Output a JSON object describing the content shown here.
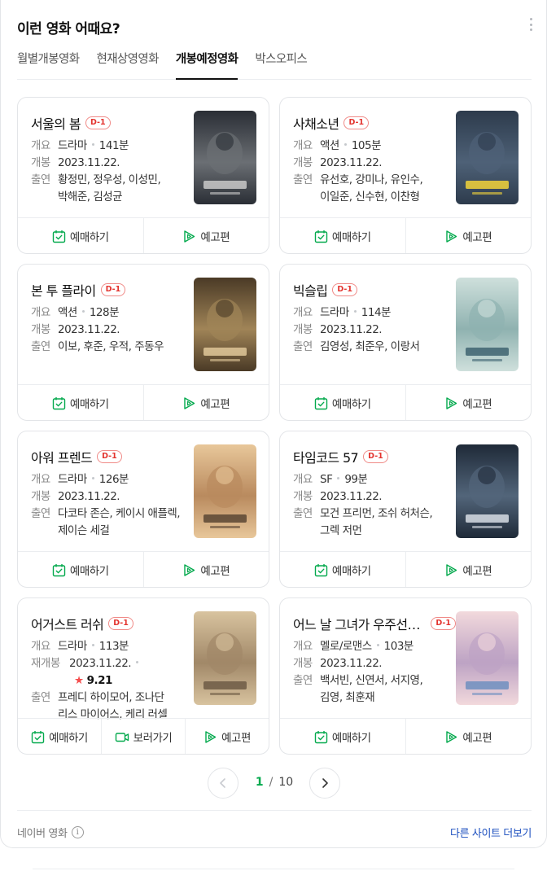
{
  "panel": {
    "title": "이런 영화 어때요?",
    "more_icon": "more-vertical-icon"
  },
  "tabs": [
    {
      "label": "월별개봉영화",
      "active": false
    },
    {
      "label": "현재상영영화",
      "active": false
    },
    {
      "label": "개봉예정영화",
      "active": true
    },
    {
      "label": "박스오피스",
      "active": false
    }
  ],
  "labels": {
    "genre_key": "개요",
    "release_key": "개봉",
    "rerelease_key": "재개봉",
    "cast_key": "출연",
    "reserve": "예매하기",
    "trailer": "예고편",
    "watch": "보러가기"
  },
  "movies": [
    {
      "title": "서울의 봄",
      "dday": "D-1",
      "genre": "드라마",
      "runtime": "141분",
      "release": "2023.11.22.",
      "cast": "황정민, 정우성, 이성민, 박해준, 김성균",
      "poster_colors": [
        "#2a2e35",
        "#6b6f74",
        "#c9c9c9"
      ]
    },
    {
      "title": "사채소년",
      "dday": "D-1",
      "genre": "액션",
      "runtime": "105분",
      "release": "2023.11.22.",
      "cast": "유선호, 강미나, 유인수, 이일준, 신수현, 이찬형",
      "poster_colors": [
        "#2d3b4c",
        "#4e6177",
        "#f2d43a"
      ]
    },
    {
      "title": "본 투 플라이",
      "dday": "D-1",
      "genre": "액션",
      "runtime": "128분",
      "release": "2023.11.22.",
      "cast": "이보, 후준, 우적, 주동우",
      "poster_colors": [
        "#4a3a26",
        "#a08457",
        "#e0c89a"
      ]
    },
    {
      "title": "빅슬립",
      "dday": "D-1",
      "genre": "드라마",
      "runtime": "114분",
      "release": "2023.11.22.",
      "cast": "김영성, 최준우, 이랑서",
      "poster_colors": [
        "#cfe0dc",
        "#8fb2b0",
        "#3e6370"
      ]
    },
    {
      "title": "아워 프렌드",
      "dday": "D-1",
      "genre": "드라마",
      "runtime": "126분",
      "release": "2023.11.22.",
      "cast": "다코타 존슨, 케이시 애플렉, 제이슨 세걸",
      "poster_colors": [
        "#e8c79a",
        "#b98a5e",
        "#5b4634"
      ]
    },
    {
      "title": "타임코드 57",
      "dday": "D-1",
      "genre": "SF",
      "runtime": "99분",
      "release": "2023.11.22.",
      "cast": "모건 프리먼, 조쉬 허처슨, 그렉 저먼",
      "poster_colors": [
        "#1f2a38",
        "#52657a",
        "#d7dde4"
      ]
    },
    {
      "title": "어거스트 러쉬",
      "dday": "D-1",
      "genre": "드라마",
      "runtime": "113분",
      "release_key": "재개봉",
      "release": "2023.11.22.",
      "rating": "9.21",
      "cast": "프레디 하이모어, 조나단 리스 마이어스, 케리 러셀",
      "poster_colors": [
        "#d8c39f",
        "#a18868",
        "#6d5a45"
      ],
      "has_watch": true
    },
    {
      "title": "어느 날 그녀가 우주선을 타고 왔다",
      "dday": "D-1",
      "genre": "멜로/로맨스",
      "runtime": "103분",
      "release": "2023.11.22.",
      "cast": "백서빈, 신연서, 서지영, 김영, 최훈재",
      "poster_colors": [
        "#f2d9dc",
        "#bda3c4",
        "#6f8fbf"
      ]
    }
  ],
  "pager": {
    "current": "1",
    "separator": "/",
    "total": "10",
    "prev_icon": "chevron-left-icon",
    "next_icon": "chevron-right-icon"
  },
  "footer": {
    "source": "네이버 영화",
    "info_icon": "info-icon",
    "more_link": "다른 사이트 더보기"
  },
  "colors": {
    "accent_green": "#03a94d",
    "dday_red": "#e3342f",
    "link_blue": "#1c4fbf"
  }
}
